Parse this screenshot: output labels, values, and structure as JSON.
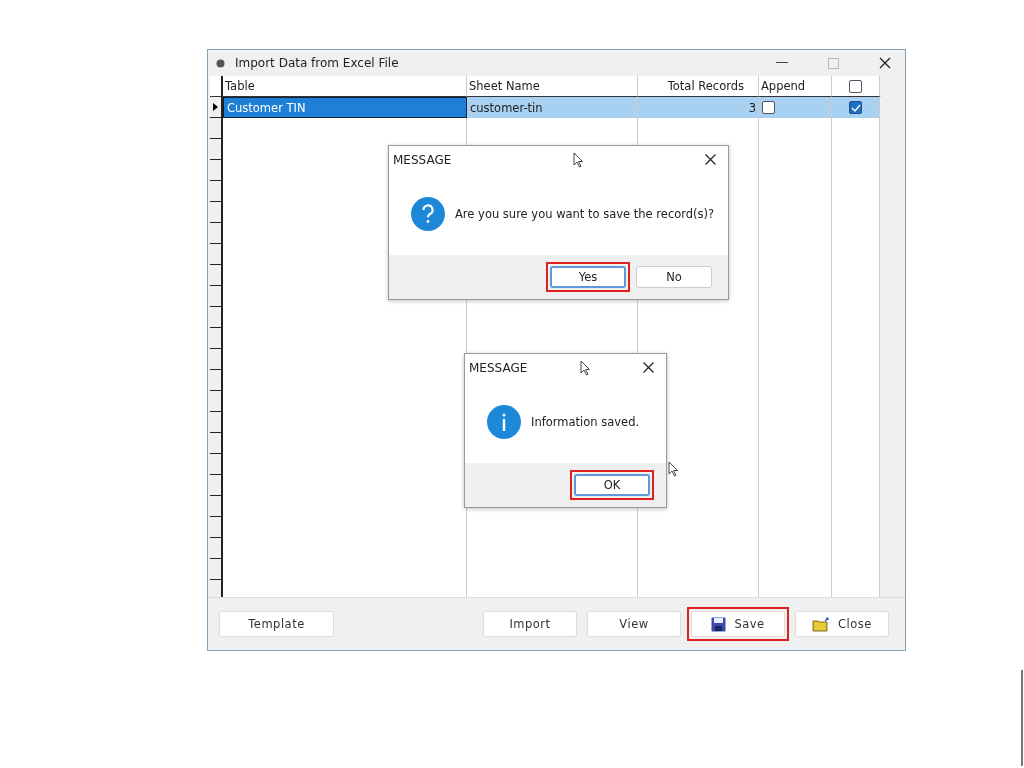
{
  "window": {
    "title": "Import Data from Excel File"
  },
  "table": {
    "columns": [
      {
        "kind": "text",
        "label": "Table"
      },
      {
        "kind": "text",
        "label": "Sheet Name"
      },
      {
        "kind": "number",
        "label": "Total Records"
      },
      {
        "kind": "text",
        "label": "Append"
      },
      {
        "kind": "checkbox",
        "checked": false
      }
    ],
    "rows": [
      {
        "selected": true,
        "current": true,
        "table": "Customer TIN",
        "sheet_name": "customer-tin",
        "total_records": "3",
        "append": false,
        "include": true
      }
    ]
  },
  "buttons": [
    {
      "kind": "plain",
      "label": "Template",
      "highlighted": false
    },
    {
      "kind": "plain",
      "label": "Import",
      "highlighted": false
    },
    {
      "kind": "plain",
      "label": "View",
      "highlighted": false
    },
    {
      "kind": "save",
      "label": "Save",
      "highlighted": true
    },
    {
      "kind": "close",
      "label": "Close",
      "highlighted": false
    }
  ],
  "dialogs": [
    {
      "kind": "question",
      "title": "MESSAGE",
      "message": "Are you sure you want to save the record(s)?",
      "buttons": [
        {
          "label": "Yes",
          "default": true,
          "highlighted": true
        },
        {
          "label": "No",
          "default": false,
          "highlighted": false
        }
      ]
    },
    {
      "kind": "info",
      "title": "MESSAGE",
      "message": "Information saved.",
      "buttons": [
        {
          "label": "OK",
          "default": true,
          "highlighted": true
        }
      ]
    }
  ]
}
